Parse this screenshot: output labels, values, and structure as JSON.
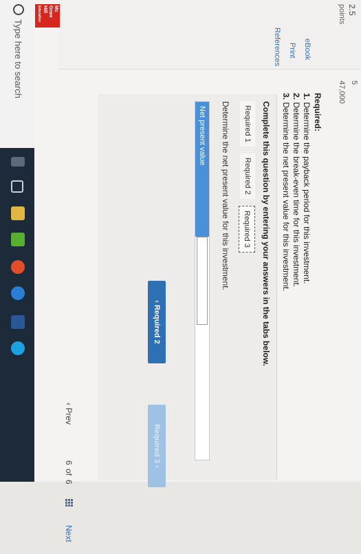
{
  "sidebar": {
    "score": "2.5",
    "points": "points",
    "ebook": "eBook",
    "print": "Print",
    "references": "References"
  },
  "top_faded": {
    "col_left": "5",
    "col_right": "47,000"
  },
  "required": {
    "title": "Required:",
    "items": [
      {
        "num": "1.",
        "text": "Determine the payback period for this investment."
      },
      {
        "num": "2.",
        "text": "Determine the break-even time for this investment."
      },
      {
        "num": "3.",
        "text": "Determine the net present value for this investment."
      }
    ]
  },
  "instructions": "Complete this question by entering your answers in the tabs below.",
  "tabs": [
    "Required 1",
    "Required 2",
    "Required 3"
  ],
  "active_tab": "Required 3",
  "tab_prompt": "Determine the net present value for this investment.",
  "npv": {
    "label": "Net present value",
    "value": ""
  },
  "buttons": {
    "prev_req": "‹  Required 2",
    "next_req": "Required 3  ›"
  },
  "pager": {
    "prev": "‹  Prev",
    "current": "6",
    "of": "of",
    "total": "6",
    "next": "Next"
  },
  "logo": {
    "line1": "Mc",
    "line2": "Graw",
    "line3": "Hill",
    "line4": "Education"
  },
  "taskbar": {
    "search_placeholder": "Type here to search"
  },
  "colors": {
    "accent": "#2f6fb3",
    "input_label_bg": "#4a90d9",
    "taskbar": "#1d2a3a"
  }
}
